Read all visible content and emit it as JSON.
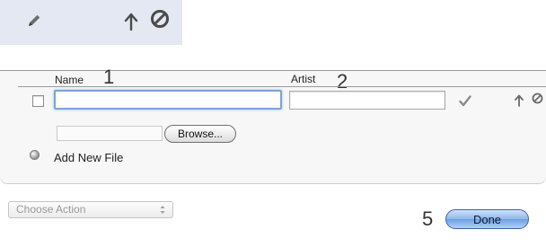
{
  "toolbar": {
    "icons": [
      "pencil-icon",
      "up-arrow-icon",
      "block-icon"
    ]
  },
  "table": {
    "columns": [
      {
        "label": "Name",
        "callout": "1"
      },
      {
        "label": "Artist",
        "callout": "2"
      }
    ],
    "row": {
      "name_value": "",
      "artist_value": "",
      "icons": [
        "checkmark-icon",
        "up-arrow-icon",
        "block-icon"
      ]
    },
    "browse_label": "Browse...",
    "add_new_file_label": "Add New File"
  },
  "footer": {
    "action_select": {
      "selected": "Choose Action"
    },
    "done_callout": "5",
    "done_label": "Done"
  },
  "colors": {
    "toolbar_bg": "#e3e8f2",
    "focus_ring": "#7aa3d9",
    "done_button": "#8fb6ea"
  }
}
